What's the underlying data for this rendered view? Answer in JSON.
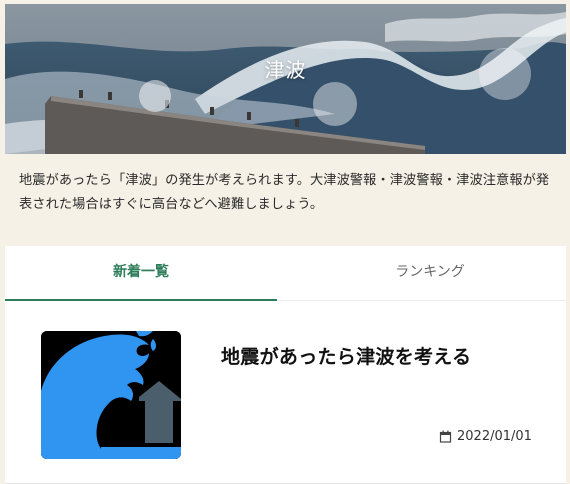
{
  "hero": {
    "title": "津波"
  },
  "description": "地震があったら「津波」の発生が考えられます。大津波警報・津波警報・津波注意報が発表された場合はすぐに高台などへ避難しましょう。",
  "tabs": [
    {
      "label": "新着一覧",
      "active": true
    },
    {
      "label": "ランキング",
      "active": false
    }
  ],
  "articles": [
    {
      "title": "地震があったら津波を考える",
      "date": "2022/01/01",
      "thumbnail_icon": "tsunami-house-icon"
    }
  ],
  "colors": {
    "background": "#f6f1e6",
    "accent": "#2e7d5a",
    "wave_blue": "#2f95f0",
    "house_gray": "#4a5f6b"
  }
}
